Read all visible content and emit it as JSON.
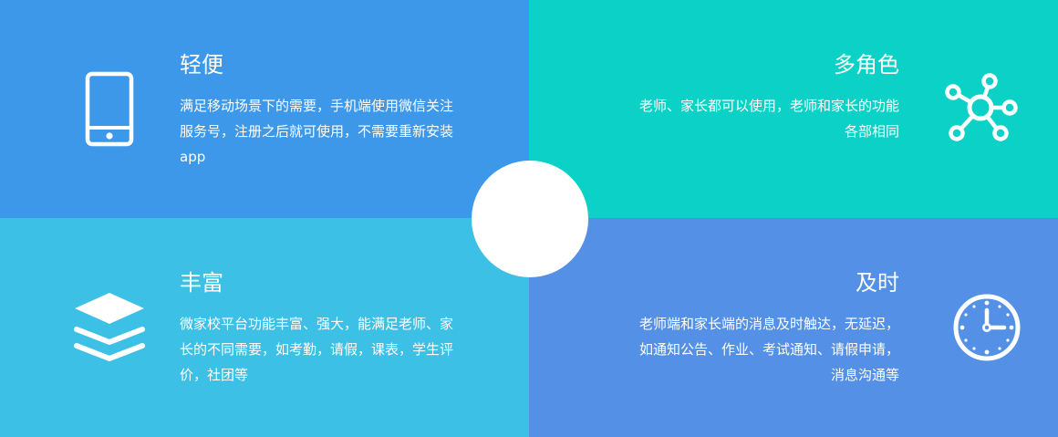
{
  "colors": {
    "panel1": "#3d98e9",
    "panel2": "#0cd1c6",
    "panel3": "#3cc0e5",
    "panel4": "#5390e6",
    "text": "#ffffff"
  },
  "features": [
    {
      "title": "轻便",
      "description": "满足移动场景下的需要，手机端使用微信关注服务号，注册之后就可使用，不需要重新安装app",
      "icon": "mobile-phone-icon"
    },
    {
      "title": "多角色",
      "description": "老师、家长都可以使用，老师和家长的功能各部相同",
      "icon": "network-hub-icon"
    },
    {
      "title": "丰富",
      "description": "微家校平台功能丰富、强大，能满足老师、家长的不同需要，如考勤，请假，课表，学生评价，社团等",
      "icon": "layers-stack-icon"
    },
    {
      "title": "及时",
      "description": "老师端和家长端的消息及时触达，无延迟，如通知公告、作业、考试通知、请假申请，消息沟通等",
      "icon": "clock-icon"
    }
  ]
}
